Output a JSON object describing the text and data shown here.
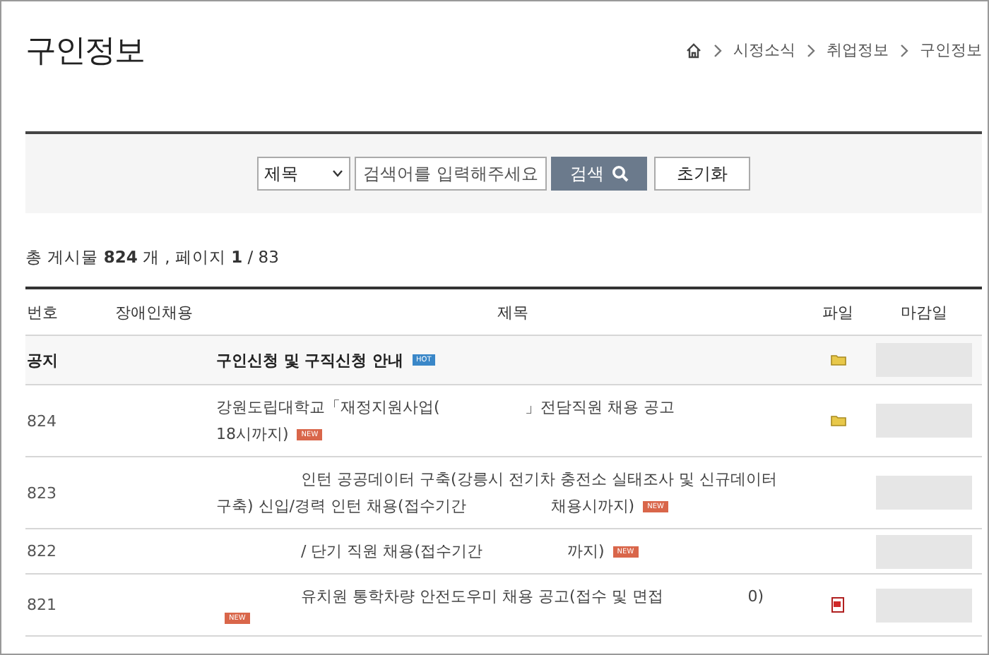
{
  "page_title": "구인정보",
  "breadcrumb": [
    "시정소식",
    "취업정보",
    "구인정보"
  ],
  "search": {
    "field": "제목",
    "placeholder": "검색어를 입력해주세요",
    "search_button": "검색",
    "reset_button": "초기화"
  },
  "summary": {
    "prefix": "총 게시물",
    "total": "824",
    "unit": "개 ,",
    "page_label": "페이지",
    "page": "1",
    "pages": "/ 83"
  },
  "table": {
    "columns": [
      "번호",
      "장애인채용",
      "제목",
      "파일",
      "마감일"
    ],
    "rows": [
      {
        "kind": "notice",
        "number": "공지",
        "lines": [
          [
            {
              "kind": "text",
              "text": "구인신청 및 구직신청 안내"
            },
            {
              "kind": "badge",
              "text": "HOT"
            }
          ]
        ],
        "attachment": {
          "kind": "folder"
        }
      },
      {
        "kind": "post",
        "number": "824",
        "lines": [
          [
            {
              "kind": "text",
              "text": "강원도립대학교「재정지원사업("
            },
            {
              "kind": "gap"
            },
            {
              "kind": "text",
              "text": "」전담직원 채용 공고"
            }
          ],
          [
            {
              "kind": "text",
              "text": "18시까지)"
            },
            {
              "kind": "badge",
              "text": "NEW"
            }
          ]
        ],
        "attachment": {
          "kind": "folder"
        }
      },
      {
        "kind": "post",
        "number": "823",
        "lines": [
          [
            {
              "kind": "gap"
            },
            {
              "kind": "text",
              "text": "인턴 공공데이터 구축(강릉시 전기차 충전소 실태조사 및 신규데이터"
            }
          ],
          [
            {
              "kind": "text",
              "text": "구축) 신입/경력 인턴 채용(접수기간"
            },
            {
              "kind": "gap"
            },
            {
              "kind": "text",
              "text": "채용시까지)"
            },
            {
              "kind": "badge",
              "text": "NEW"
            }
          ]
        ]
      },
      {
        "kind": "post",
        "number": "822",
        "lines": [
          [
            {
              "kind": "gap"
            },
            {
              "kind": "text",
              "text": "/ 단기 직원 채용(접수기간"
            },
            {
              "kind": "gap"
            },
            {
              "kind": "text",
              "text": "까지)"
            },
            {
              "kind": "badge",
              "text": "NEW"
            }
          ]
        ]
      },
      {
        "kind": "post",
        "number": "821",
        "lines": [
          [
            {
              "kind": "gap"
            },
            {
              "kind": "text",
              "text": "유치원 통학차량 안전도우미 채용 공고(접수 및 면접"
            },
            {
              "kind": "gap"
            },
            {
              "kind": "text",
              "text": "0)"
            }
          ],
          [
            {
              "kind": "badge",
              "text": "NEW"
            }
          ]
        ],
        "attachment": {
          "kind": "document"
        }
      }
    ]
  }
}
